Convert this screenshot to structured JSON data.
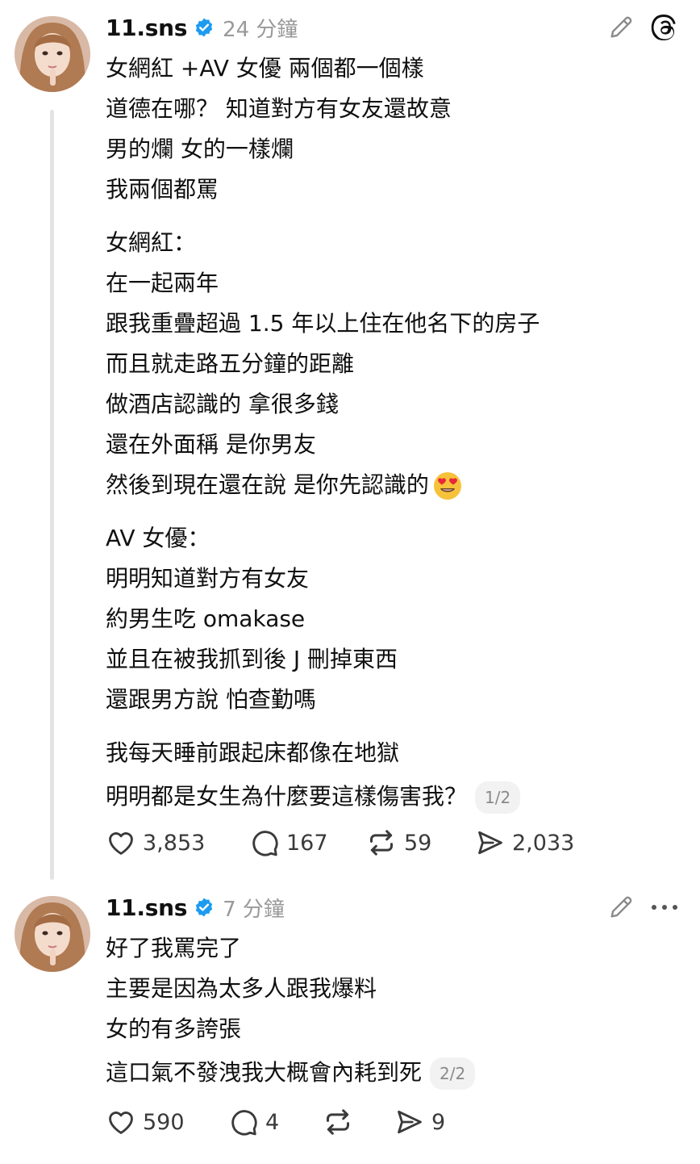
{
  "posts": [
    {
      "username": "11.sns",
      "time": "24 分鐘",
      "lines_a": [
        "女網紅 +AV 女優 兩個都一個樣",
        "道德在哪？  知道對方有女友還故意",
        "男的爛 女的一樣爛",
        "我兩個都罵"
      ],
      "lines_b": [
        "女網紅：",
        "在一起兩年",
        "跟我重疊超過 1.5 年以上住在他名下的房子",
        "而且就走路五分鐘的距離",
        "做酒店認識的 拿很多錢",
        "還在外面稱 是你男友",
        "然後到現在還在說 是你先認識的"
      ],
      "emoji": "heart-eyes-emoji",
      "lines_c": [
        "AV 女優：",
        "明明知道對方有女友",
        "約男生吃 omakase",
        "並且在被我抓到後 J 刪掉東西",
        "還跟男方說 怕查勤嗎"
      ],
      "lines_d": [
        "我每天睡前跟起床都像在地獄",
        "明明都是女生為什麼要這樣傷害我？"
      ],
      "page": "1/2",
      "likes": "3,853",
      "replies": "167",
      "reposts": "59",
      "shares": "2,033"
    },
    {
      "username": "11.sns",
      "time": "7 分鐘",
      "lines": [
        "好了我罵完了",
        "主要是因為太多人跟我爆料",
        "女的有多誇張",
        "這口氣不發洩我大概會內耗到死"
      ],
      "page": "2/2",
      "likes": "590",
      "replies": "4",
      "reposts": "",
      "shares": "9"
    }
  ],
  "icons": {
    "edit": "pencil-icon",
    "app": "threads-logo-icon",
    "more": "more-options-icon",
    "like": "heart-icon",
    "reply": "comment-icon",
    "repost": "repost-icon",
    "share": "share-icon",
    "verified": "verified-badge-icon"
  },
  "colors": {
    "verified": "#1d9bf0",
    "muted": "#999999",
    "text": "#101010"
  }
}
